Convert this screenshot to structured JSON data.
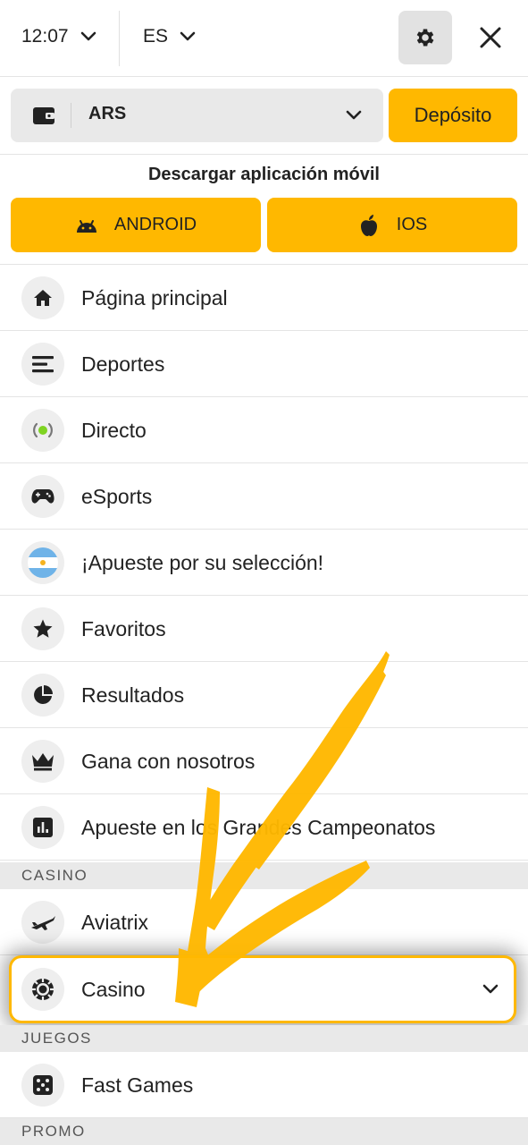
{
  "header": {
    "time": "12:07",
    "language": "ES"
  },
  "wallet": {
    "currency": "ARS",
    "deposit_label": "Depósito"
  },
  "download": {
    "title": "Descargar aplicación móvil",
    "android_label": "ANDROID",
    "ios_label": "IOS"
  },
  "menu": {
    "items": [
      {
        "label": "Página principal",
        "icon": "home-icon"
      },
      {
        "label": "Deportes",
        "icon": "list-icon"
      },
      {
        "label": "Directo",
        "icon": "live-icon"
      },
      {
        "label": "eSports",
        "icon": "gamepad-icon"
      },
      {
        "label": "¡Apueste por su selección!",
        "icon": "argentina-flag-icon"
      },
      {
        "label": "Favoritos",
        "icon": "star-icon"
      },
      {
        "label": "Resultados",
        "icon": "pie-chart-icon"
      },
      {
        "label": "Gana con nosotros",
        "icon": "crown-icon"
      },
      {
        "label": "Apueste en los Grandes Campeonatos",
        "icon": "bar-chart-icon"
      }
    ]
  },
  "sections": {
    "casino_title": "CASINO",
    "juegos_title": "JUEGOS",
    "promo_title": "PROMO"
  },
  "casino": {
    "aviatrix_label": "Aviatrix",
    "casino_label": "Casino"
  },
  "juegos": {
    "fast_games_label": "Fast Games"
  },
  "colors": {
    "accent": "#ffb800",
    "live_green": "#7ed321"
  }
}
